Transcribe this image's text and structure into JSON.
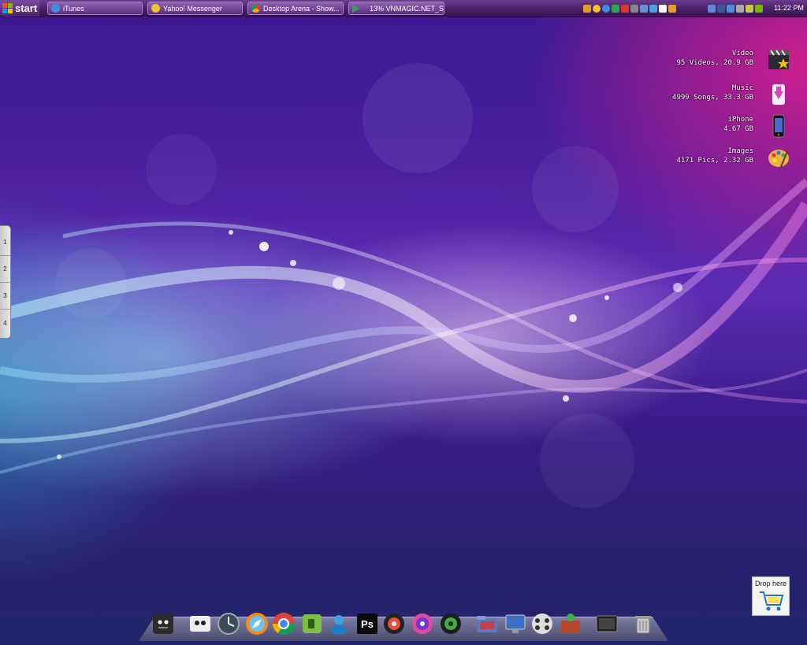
{
  "taskbar": {
    "start_label": "start",
    "buttons": [
      {
        "label": "iTunes",
        "icon": "itunes-icon",
        "color": "#3a8ee6"
      },
      {
        "label": "Yahoo! Messenger",
        "icon": "yahoo-messenger-icon",
        "color": "#f2c230"
      },
      {
        "label": "Desktop Arena - Show...",
        "icon": "chrome-icon",
        "color": "#4caf50"
      },
      {
        "label": "13% VNMAGIC.NET_S...",
        "icon": "download-icon",
        "color": "#2ea84a"
      }
    ],
    "clock": "11:22 PM"
  },
  "widgets": [
    {
      "title": "Video",
      "detail": "95 Videos, 20.9 GB",
      "icon": "video-icon"
    },
    {
      "title": "Music",
      "detail": "4999 Songs, 33.3 GB",
      "icon": "music-icon"
    },
    {
      "title": "iPhone",
      "detail": "4.67 GB",
      "icon": "iphone-icon"
    },
    {
      "title": "Images",
      "detail": "4171 Pics, 2.32 GB",
      "icon": "paint-palette-icon"
    }
  ],
  "pager": [
    "1",
    "2",
    "3",
    "4"
  ],
  "dock": [
    "finder-icon",
    "system-icon",
    "clock-icon",
    "safari-icon",
    "chrome-icon",
    "evernote-icon",
    "messenger-icon",
    "photoshop-icon",
    "media-player-icon",
    "itunes-icon",
    "spotify-icon",
    "folder-icon",
    "monitor-icon",
    "film-icon",
    "toolbox-icon",
    "display-icon",
    "trash-icon"
  ],
  "dock_labels": {
    "photoshop": "Ps"
  },
  "drop_widget": {
    "label": "Drop here"
  }
}
